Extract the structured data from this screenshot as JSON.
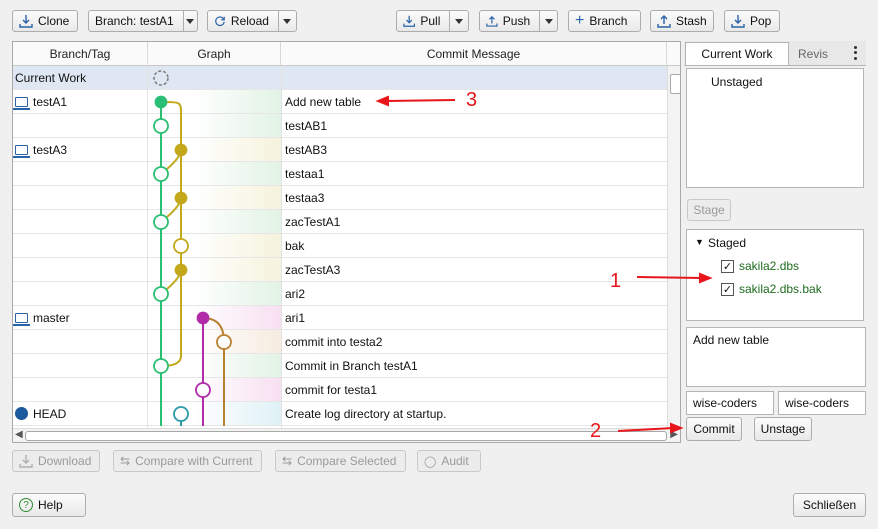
{
  "toolbar": {
    "clone": "Clone",
    "branch": "Branch: testA1",
    "reload": "Reload",
    "pull": "Pull",
    "push": "Push",
    "branch_btn": "Branch",
    "stash": "Stash",
    "pop": "Pop"
  },
  "table": {
    "headers": [
      "Branch/Tag",
      "Graph",
      "Commit Message"
    ],
    "rows": [
      {
        "branch": "Current Work",
        "message": ""
      },
      {
        "branch": "testA1",
        "message": "Add new table"
      },
      {
        "branch": "",
        "message": "testAB1"
      },
      {
        "branch": "testA3",
        "message": "testAB3"
      },
      {
        "branch": "",
        "message": "testaa1"
      },
      {
        "branch": "",
        "message": "testaa3"
      },
      {
        "branch": "",
        "message": "zacTestA1"
      },
      {
        "branch": "",
        "message": "bak"
      },
      {
        "branch": "",
        "message": "zacTestA3"
      },
      {
        "branch": "",
        "message": "ari2"
      },
      {
        "branch": "master",
        "message": "ari1"
      },
      {
        "branch": "",
        "message": "commit into testa2"
      },
      {
        "branch": "",
        "message": "Commit in Branch testA1"
      },
      {
        "branch": "",
        "message": "commit for testa1"
      },
      {
        "branch": "HEAD",
        "message": "Create log directory at startup."
      }
    ]
  },
  "right": {
    "tab_current": "Current Work",
    "tab_revis": "Revis",
    "unstaged_label": "Unstaged",
    "stage": "Stage",
    "staged_label": "Staged",
    "staged_files": [
      "sakila2.dbs",
      "sakila2.dbs.bak"
    ],
    "commit_message": "Add new table",
    "author_name": "wise-coders",
    "author_email": "wise-coders",
    "commit": "Commit",
    "unstage": "Unstage"
  },
  "bottom": {
    "download": "Download",
    "compare_current": "Compare with Current",
    "compare_selected": "Compare Selected",
    "audit": "Audit",
    "help": "Help",
    "close": "Schließen"
  },
  "annotations": {
    "a1": "1",
    "a2": "2",
    "a3": "3"
  },
  "colors": {
    "accent": "#2a63a8",
    "annotation": "#e8161b",
    "selected_row": "#dfe7f3"
  }
}
